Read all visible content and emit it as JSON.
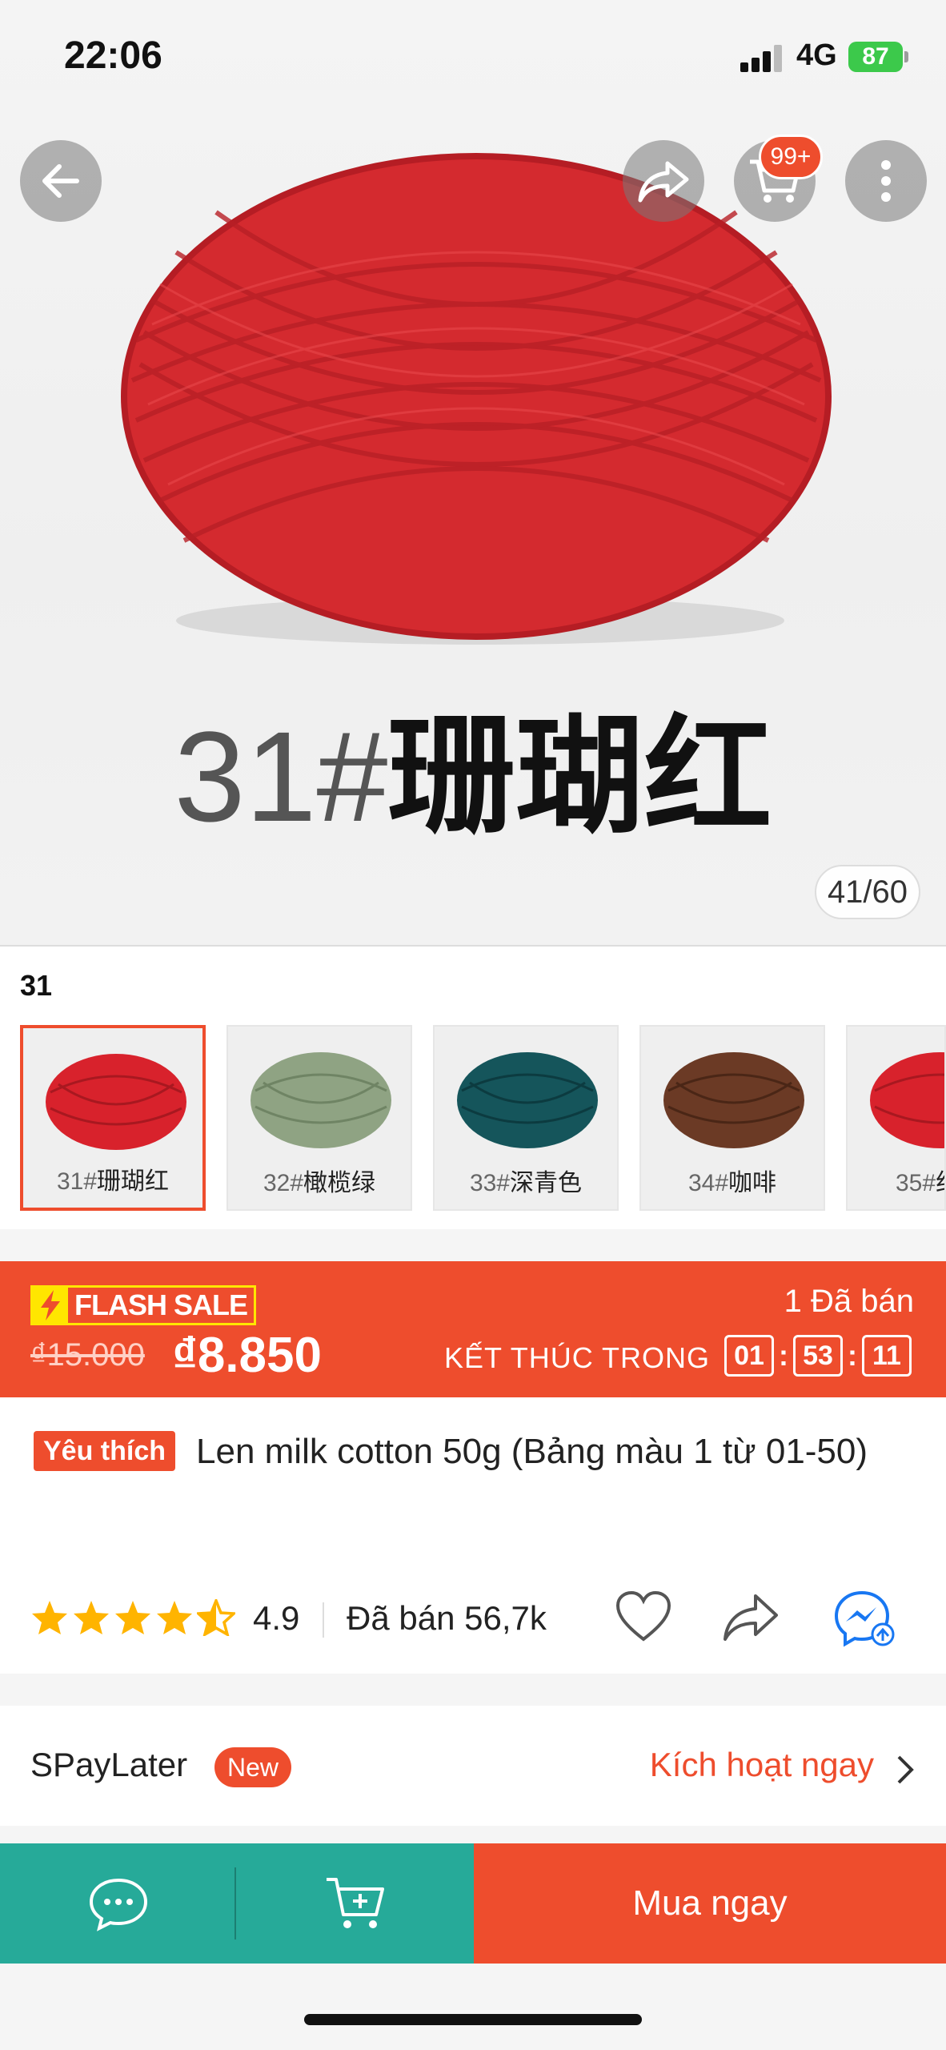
{
  "status_bar": {
    "time": "22:06",
    "network": "4G",
    "battery": "87"
  },
  "header": {
    "cart_badge": "99+"
  },
  "hero": {
    "caption_number": "31#",
    "caption_text": "珊瑚红",
    "image_counter": "41/60"
  },
  "variants": {
    "title": "31",
    "items": [
      {
        "number": "31#",
        "name": "珊瑚红",
        "color": "#d8222c",
        "selected": true
      },
      {
        "number": "32#",
        "name": "橄榄绿",
        "color": "#8fa383",
        "selected": false
      },
      {
        "number": "33#",
        "name": "深青色",
        "color": "#15555b",
        "selected": false
      },
      {
        "number": "34#",
        "name": "咖啡",
        "color": "#6b3a25",
        "selected": false
      },
      {
        "number": "35#",
        "name": "红",
        "color": "#d8222c",
        "selected": false
      }
    ]
  },
  "flash_sale": {
    "badge": "FLASH SALE",
    "sold": "1 Đã bán",
    "old_price": "₫15.000",
    "new_price": "₫8.850",
    "ends_label": "KẾT THÚC TRONG",
    "hours": "01",
    "minutes": "53",
    "seconds": "11"
  },
  "product": {
    "favorite_tag": "Yêu thích",
    "title": "Len milk cotton 50g (Bảng màu 1 từ 01-50)",
    "rating": "4.9",
    "sold_total": "Đã bán 56,7k"
  },
  "spaylater": {
    "name": "SPayLater",
    "new_tag": "New",
    "action": "Kích hoạt ngay"
  },
  "bottom_bar": {
    "buy_now": "Mua ngay"
  },
  "colors": {
    "accent": "#ee4d2d",
    "teal": "#26aa99",
    "star": "#ffb400"
  }
}
